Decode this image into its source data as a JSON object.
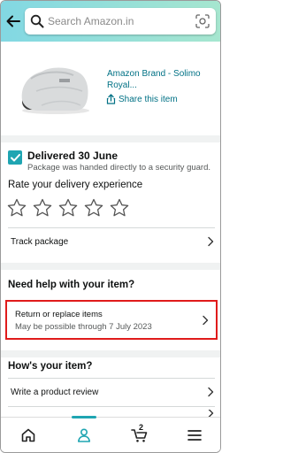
{
  "header": {
    "search_placeholder": "Search Amazon.in"
  },
  "product": {
    "title": "Amazon Brand - Solimo Royal...",
    "share_label": "Share this item"
  },
  "delivery": {
    "title": "Delivered 30 June",
    "subtitle": "Package was handed directly to a security guard.",
    "rate_label": "Rate your delivery experience",
    "star_rating": 0,
    "track_label": "Track package"
  },
  "help": {
    "title": "Need help with your item?",
    "return_label": "Return or replace items",
    "return_sub": "May be possible through 7 July 2023"
  },
  "review": {
    "title": "How's your item?",
    "write_review_label": "Write a product review"
  },
  "bottom_nav": {
    "cart_count": "2"
  },
  "colors": {
    "accent": "#1fa5b2",
    "link": "#007185",
    "highlight_border": "#e01b1b"
  }
}
